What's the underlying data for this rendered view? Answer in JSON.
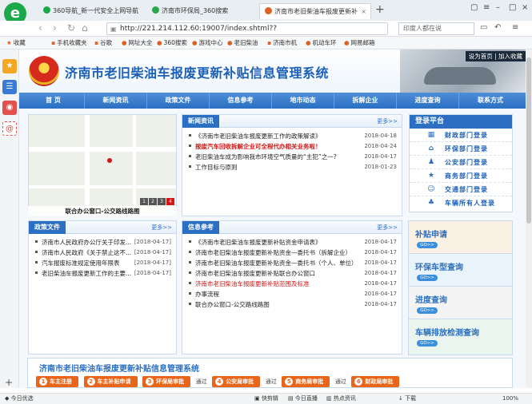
{
  "browser": {
    "tabs": [
      {
        "label": "360导航_新一代安全上网导航",
        "color": "#1aa84a",
        "active": false
      },
      {
        "label": "济南市环保局_360搜索",
        "color": "#2aa64b",
        "active": false
      },
      {
        "label": "济南市老旧柴油车报废更新补",
        "color": "#e0601e",
        "active": true
      }
    ],
    "new_tab": "+",
    "url": "http://221.214.112.60:19007/index.shtml??",
    "search_placeholder": "印度人都在说",
    "bookmarks": [
      "收藏",
      "手机收藏夹",
      "谷歌",
      "网址大全",
      "360搜索",
      "游戏中心",
      "老旧柴油",
      "济南市机",
      "机动车环",
      "网易邮箱"
    ]
  },
  "site": {
    "title": "济南市老旧柴油车报废更新补贴信息管理系统",
    "top_links": "设为首页 | 加入收藏",
    "nav": [
      "首  页",
      "新闻资讯",
      "政策文件",
      "信息参考",
      "地市动态",
      "拆解企业",
      "进度查询",
      "联系方式"
    ]
  },
  "map": {
    "caption": "联合办公窗口-公交路线路图",
    "pager": [
      "1",
      "2",
      "3",
      "4"
    ]
  },
  "news": {
    "title": "新闻资讯",
    "more": "更多>>",
    "items": [
      {
        "text": "《济南市老旧柴油车报废更新工作的政策解读》",
        "date": "2018-04-18",
        "style": ""
      },
      {
        "text": "报废汽车回收拆解企业可全程代办相关业务啦！",
        "date": "2018-04-24",
        "style": "red"
      },
      {
        "text": "老旧柴油车成为影响我市环境空气质量的“主犯”之一?",
        "date": "2018-04-17",
        "style": ""
      },
      {
        "text": "工作目标与原则",
        "date": "2018-01-23",
        "style": ""
      }
    ]
  },
  "login": {
    "title": "登录平台",
    "items": [
      {
        "label": "财政部门登录",
        "icon": "▦"
      },
      {
        "label": "环保部门登录",
        "icon": "⌂"
      },
      {
        "label": "公安部门登录",
        "icon": "♟"
      },
      {
        "label": "商务部门登录",
        "icon": "★"
      },
      {
        "label": "交通部门登录",
        "icon": "☺"
      },
      {
        "label": "车辆所有人登录",
        "icon": "♣"
      }
    ]
  },
  "policy": {
    "title": "政策文件",
    "more": "更多>>",
    "items": [
      {
        "text": "济南市人民政府办公厅关于印发...",
        "date": "[2018-04-17]"
      },
      {
        "text": "济南市人民政府《关于禁止这不...",
        "date": "[2018-04-17]"
      },
      {
        "text": "汽车报废标准规定使用年限表",
        "date": "[2018-04-17]"
      },
      {
        "text": "老旧柴油车报废更新工作的主要...",
        "date": "[2018-04-17]"
      }
    ]
  },
  "info": {
    "title": "信息参考",
    "more": "更多>>",
    "items": [
      {
        "text": "《济南市老旧柴油车报废更新补贴资金申请表》",
        "date": "2018-04-17",
        "style": ""
      },
      {
        "text": "济南市老旧柴油车报废更新补贴资金—委托书（拆解企业）",
        "date": "2018-04-17",
        "style": ""
      },
      {
        "text": "济南市老旧柴油车报废更新补贴资金—委托书（个人、单位）",
        "date": "2018-04-17",
        "style": ""
      },
      {
        "text": "济南市老旧柴油车报废更新补贴联合办公窗口",
        "date": "2018-04-17",
        "style": ""
      },
      {
        "text": "济南市老旧柴油车报废更新补贴范围及标准",
        "date": "2018-04-17",
        "style": "redlight"
      },
      {
        "text": "办事流程",
        "date": "2018-04-17",
        "style": ""
      },
      {
        "text": "联合办公窗口-公交路线路图",
        "date": "2018-04-17",
        "style": ""
      }
    ]
  },
  "promos": [
    {
      "label": "补贴申请",
      "go": "GO>>",
      "bg": "#fbf0e4"
    },
    {
      "label": "环保车型查询",
      "go": "GO>>",
      "bg": "#e9f3fb"
    },
    {
      "label": "进度查询",
      "go": "GO>>",
      "bg": "#f4f4f4"
    },
    {
      "label": "车辆排放检测查询",
      "go": "GO>>",
      "bg": "#e9f5ee"
    }
  ],
  "flow": {
    "title": "济南市老旧柴油车报废更新补贴信息管理系统",
    "steps": [
      {
        "num": "1",
        "label": "车主注册"
      },
      {
        "num": "2",
        "label": "车主补贴申请"
      },
      {
        "num": "3",
        "label": "环保局审批"
      },
      {
        "num": "4",
        "label": "公安局审批"
      },
      {
        "num": "5",
        "label": "商务局审批"
      },
      {
        "num": "6",
        "label": "财政局审批"
      }
    ],
    "pass": "通过"
  },
  "statusbar": [
    "今日优选",
    "快剪辑",
    "今日直播",
    "热点资讯",
    "下载",
    "100%"
  ]
}
